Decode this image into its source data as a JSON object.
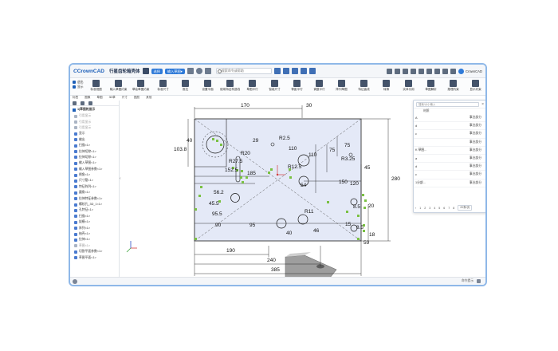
{
  "app": {
    "brand": "CrownCAD",
    "title": "行星齿轮箱壳体",
    "pill_1": "选择",
    "pill_2": "输入草图▾",
    "search_placeholder": "搜索命令或帮助",
    "user": "CrownCAD"
  },
  "ribbon": {
    "left": [
      "退出",
      "显示"
    ],
    "groups": [
      "标准视图",
      "输入草图约束",
      "草绘草图约束",
      "标准尺寸",
      "推拉",
      "设置平面",
      "使用特征构造线",
      "草图平行",
      "智能尺寸",
      "等距平行",
      "调整平行",
      "阵列草图",
      "特征曲线",
      "转换",
      "实体引用",
      "草图解析",
      "推理约束",
      "显示约束",
      "其他工具"
    ]
  },
  "menutabs": [
    "标签",
    "图像",
    "草图",
    "3D草",
    "尺寸",
    "图层",
    "其他"
  ],
  "sidebar": {
    "head": "1|草图的显示",
    "items": [
      {
        "label": "引用显示",
        "muted": true
      },
      {
        "label": "引用显示",
        "muted": true
      },
      {
        "label": "引用显示",
        "muted": true
      },
      {
        "label": "显示",
        "muted": false
      },
      {
        "label": "输出",
        "muted": false
      },
      {
        "label": "扫描<1>",
        "muted": false
      },
      {
        "label": "拉伸切除<1>",
        "muted": false
      },
      {
        "label": "拉伸切除<1>",
        "muted": false
      },
      {
        "label": "输入草图<1>",
        "muted": false
      },
      {
        "label": "输入草图参数<1>",
        "muted": false
      },
      {
        "label": "倒角<1>",
        "muted": false
      },
      {
        "label": "尺寸筋<1>",
        "muted": false
      },
      {
        "label": "特征阵列<1>",
        "muted": false
      },
      {
        "label": "圆角<1>",
        "muted": false
      },
      {
        "label": "拉伸特征参数<1>",
        "muted": false
      },
      {
        "label": "螺纹孔_3D_1<1>",
        "muted": false
      },
      {
        "label": "孔特征<1>",
        "muted": false
      },
      {
        "label": "扫描<1>",
        "muted": false
      },
      {
        "label": "拔模<1>",
        "muted": false
      },
      {
        "label": "阵列<1>",
        "muted": false
      },
      {
        "label": "抽壳<1>",
        "muted": false
      },
      {
        "label": "拉伸<1>",
        "muted": false
      },
      {
        "label": "草图<1>",
        "muted": true
      },
      {
        "label": "切割平面参数<1>",
        "muted": false
      },
      {
        "label": "草图平面<1>",
        "muted": false
      }
    ]
  },
  "dims": [
    "170",
    "30",
    "R2.5",
    "29",
    "40",
    "103.8",
    "110",
    "R20",
    "R27.5",
    "152.5",
    "110",
    "75",
    "75",
    "R3.25",
    "45",
    "R12.5",
    "185",
    "150",
    "120",
    "54",
    "56.2",
    "45.5",
    "95.5",
    "90",
    "95",
    "8.5",
    "20",
    "280",
    "R11",
    "15",
    "8.5",
    "40",
    "46",
    "18",
    "59",
    "190",
    "240",
    "385"
  ],
  "panel": {
    "search_placeholder": "搜索/大小输入",
    "column": "材质",
    "rows": [
      {
        "key": "A",
        "value": "事业部分"
      },
      {
        "key": "d",
        "value": "事业部分"
      },
      {
        "key": "c",
        "value": "事业部分"
      },
      {
        "key": "",
        "value": "事业部分"
      },
      {
        "key": "K 草图...",
        "value": "事业部分"
      },
      {
        "key": "a",
        "value": "事业部分"
      },
      {
        "key": "d",
        "value": "事业部分"
      },
      {
        "key": "c",
        "value": "事业部分"
      },
      {
        "key": "1分部...",
        "value": "事业部分"
      }
    ],
    "pager": [
      "1",
      "2",
      "3",
      "4",
      "5",
      "6",
      "7",
      "8",
      "20条/页"
    ]
  },
  "status": {
    "right": "命令提示"
  },
  "colors": {
    "accent": "#2f7ad8",
    "sketch_fill": "#e4e9f7",
    "sketch_line": "#1a1a1a",
    "constraint": "#7ac143"
  }
}
